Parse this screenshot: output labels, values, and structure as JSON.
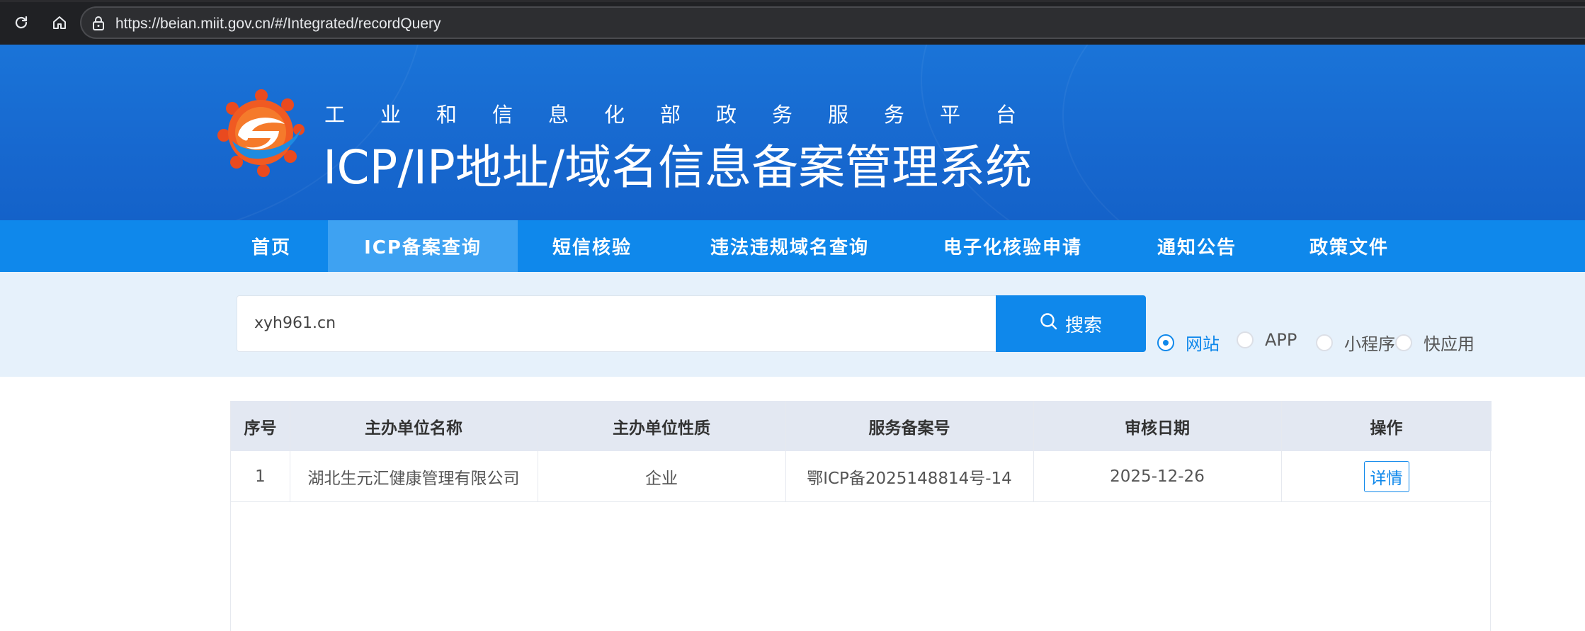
{
  "browser": {
    "url": "https://beian.miit.gov.cn/#/Integrated/recordQuery",
    "reload_icon": "reload-icon",
    "home_icon": "home-icon",
    "lock_icon": "lock-icon"
  },
  "banner": {
    "subtitle": "工业和信息化部政务服务平台",
    "title": "ICP/IP地址/域名信息备案管理系统",
    "logo_icon": "miit-gear-logo"
  },
  "nav": {
    "items": [
      {
        "label": "首页"
      },
      {
        "label": "ICP备案查询",
        "active": true
      },
      {
        "label": "短信核验"
      },
      {
        "label": "违法违规域名查询"
      },
      {
        "label": "电子化核验申请"
      },
      {
        "label": "通知公告"
      },
      {
        "label": "政策文件"
      }
    ]
  },
  "search": {
    "value": "xyh961.cn",
    "button_label": "搜索",
    "button_icon": "search-icon",
    "types": [
      {
        "label": "网站",
        "checked": true
      },
      {
        "label": "APP",
        "checked": false
      },
      {
        "label": "小程序",
        "checked": false
      },
      {
        "label": "快应用",
        "checked": false
      }
    ]
  },
  "table": {
    "headers": [
      "序号",
      "主办单位名称",
      "主办单位性质",
      "服务备案号",
      "审核日期",
      "操作"
    ],
    "rows": [
      {
        "index": "1",
        "org_name": "湖北生元汇健康管理有限公司",
        "org_type": "企业",
        "record_no": "鄂ICP备2025148814号-14",
        "audit_date": "2025-12-26",
        "action_label": "详情"
      }
    ]
  },
  "colors": {
    "brand_blue": "#0f88eb",
    "banner_blue": "#1768cf",
    "nav_active": "#3ea2f2",
    "search_bg": "#e6f1fb",
    "table_header_bg": "#e3e8f2"
  }
}
